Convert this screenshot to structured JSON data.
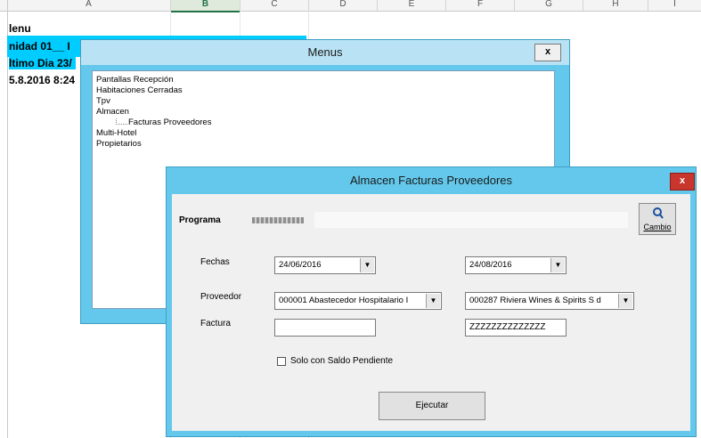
{
  "spreadsheet": {
    "columns": [
      "A",
      "B",
      "C",
      "D",
      "E",
      "F",
      "G",
      "H",
      "I"
    ],
    "selected_column": "B",
    "cells": [
      "lenu",
      "nidad 01__ I",
      "ltimo Dia 23/",
      "5.8.2016 8:24"
    ],
    "highlight_color": "#00ccff"
  },
  "menus_window": {
    "title": "Menus",
    "close_label": "x",
    "tree": [
      "Pantallas Recepción",
      "Habitaciones Cerradas",
      "Tpv",
      "Almacen",
      "Facturas Proveedores",
      "Multi-Hotel",
      "Propietarios"
    ]
  },
  "almacen_window": {
    "title": "Almacen Facturas Proveedores",
    "close_label": "x",
    "programa_label": "Programa",
    "programa_value": "",
    "cambio_label": "Cambio",
    "fechas_label": "Fechas",
    "fecha_desde": "24/06/2016",
    "fecha_hasta": "24/08/2016",
    "proveedor_label": "Proveedor",
    "proveedor_desde": "000001  Abastecedor Hospitalario I",
    "proveedor_hasta": "000287  Riviera Wines & Spirits S d",
    "factura_label": "Factura",
    "factura_desde": "",
    "factura_hasta": "ZZZZZZZZZZZZZZ",
    "saldo_label": "Solo con Saldo Pendiente",
    "saldo_checked": false,
    "ejecutar_label": "Ejecutar",
    "accent_color": "#63c8ec"
  }
}
